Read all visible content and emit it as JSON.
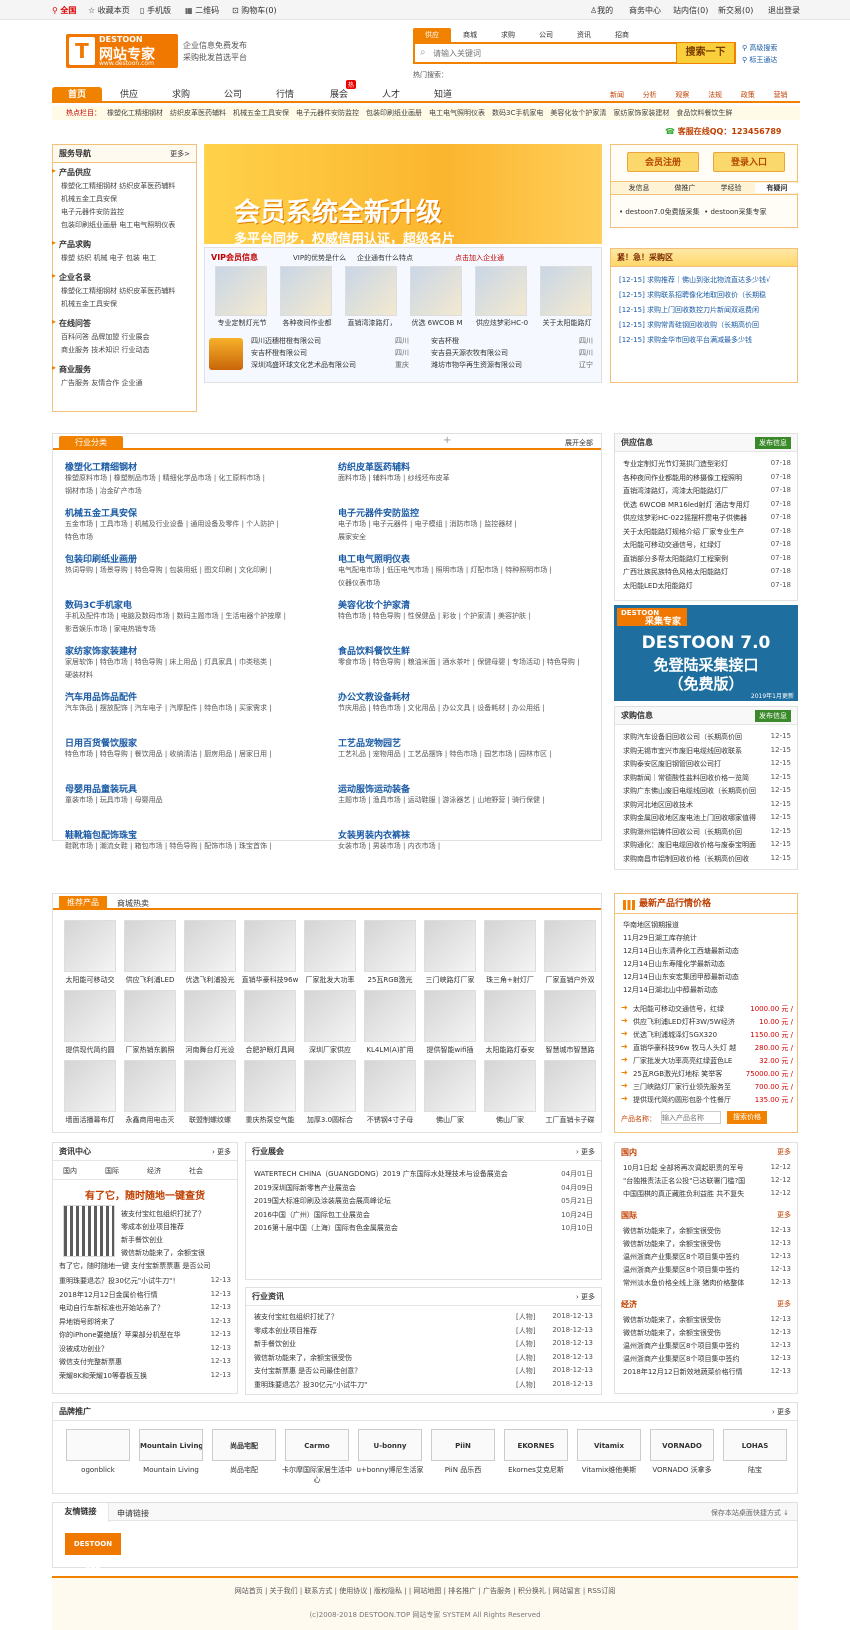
{
  "topbar": {
    "home": "全国",
    "fav": "收藏本页",
    "mobile": "手机版",
    "qr": "二维码",
    "cart": "购物车(0)",
    "me": "我的",
    "biz": "商务中心",
    "msg": "站内信(0)",
    "trade": "新交易(0)",
    "logout": "退出登录"
  },
  "logo": {
    "brand": "DESTOON",
    "name": "网站专家",
    "url": "www.destoon.com",
    "slogan1": "企业信息免费发布",
    "slogan2": "采购批发首选平台"
  },
  "search": {
    "tabs": [
      "供应",
      "商城",
      "求购",
      "公司",
      "资讯",
      "招商"
    ],
    "placeholder": "请输入关键词",
    "button": "搜索一下",
    "adv": "高级搜索",
    "label": "标王通达",
    "hot_label": "热门搜索："
  },
  "nav": {
    "items": [
      "首页",
      "供应",
      "求购",
      "公司",
      "行情",
      "展会",
      "人才",
      "知道"
    ],
    "hot_badge": "热",
    "sub": [
      "新闻",
      "分析",
      "观察",
      "法规",
      "政策",
      "营销"
    ]
  },
  "hotbar": {
    "label": "热点栏目：",
    "items": [
      "橡塑化工精细钢材",
      "纺织皮革医药辅料",
      "机械五金工具安保",
      "电子元器件安防监控",
      "包装印刷纸业画册",
      "电工电气照明仪表",
      "数码3C手机家电",
      "美容化妆个护家清",
      "家纺家饰家装建材",
      "食品饮料餐饮生鲜"
    ]
  },
  "qq": "客服在线QQ：123456789",
  "service_nav": {
    "title": "服务导航",
    "more": "更多>",
    "sections": [
      {
        "title": "产品供应",
        "rows": [
          "橡塑化工精细钢材  纺织皮革医药辅料",
          "机械五金工具安保",
          "电子元器件安防监控",
          "包装印刷纸业画册  电工电气照明仪表"
        ]
      },
      {
        "title": "产品求购",
        "rows": [
          "橡塑  纺织  机械  电子  包装  电工"
        ]
      },
      {
        "title": "企业名录",
        "rows": [
          "橡塑化工精细钢材  纺织皮革医药辅料",
          "机械五金工具安保"
        ]
      },
      {
        "title": "在线问答",
        "rows": [
          "百科问答  品牌加盟  行业展会",
          "商业服务  技术知识  行业动态"
        ]
      },
      {
        "title": "商业服务",
        "rows": [
          "广告服务  友情合作  企业通"
        ]
      }
    ]
  },
  "banner": {
    "title": "会员系统全新升级",
    "sub": "多平台同步，权威信用认证，超级名片"
  },
  "vip": {
    "tabs": [
      "VIP会员信息",
      "VIP的优势是什么",
      "企业通有什么特点",
      "点击加入企业通"
    ],
    "items": [
      "专业定制灯光节",
      "各种夜间作业都",
      "直销湾漆路灯，",
      "优选 6WCOB M",
      "供应炫梦彩HC-0",
      "关于太阳能路灯"
    ],
    "companies": [
      [
        "四川迈穗柑橙有限公司",
        "四川",
        "安吉杯橙",
        "四川"
      ],
      [
        "安吉杯橙有限公司",
        "四川",
        "安吉县天源农牧有限公司",
        "四川"
      ],
      [
        "深圳鸿盛环球文化艺术品有限公司",
        "重庆",
        "潍坊市物华再生资源有限公司",
        "辽宁"
      ]
    ]
  },
  "member": {
    "register": "会员注册",
    "login": "登录入口",
    "tabs": [
      "发信息",
      "做推广",
      "学经验",
      "有疑问"
    ],
    "items": [
      "destoon7.0免费版采集",
      "destoon采集专家"
    ]
  },
  "urgent": {
    "title": "紧！急！采购区",
    "items": [
      "[12-15] 求购推荐｜佛山到张北物流直达多少钱√",
      "[12-15] 求购联系招聘像化地取回收价（长期稳",
      "[12-15] 求购上门回收数控刀片新闻双返费闲",
      "[12-15] 求购常青硅钢回收收购（长期高价回",
      "[12-15] 求购金华市回收平台满减最多少钱"
    ]
  },
  "industry": {
    "tab": "行业分类",
    "expand": "展开全部",
    "cats": [
      {
        "t": "橡塑化工精细钢材",
        "s": [
          "橡塑原料市场  |  橡塑制品市场  |  精细化学品市场  |  化工原料市场  |",
          "钢材市场  |  冶金矿产市场"
        ]
      },
      {
        "t": "纺织皮革医药辅料",
        "s": [
          "面料市场  |  辅料市场  |  纱线坯布皮革"
        ]
      },
      {
        "t": "机械五金工具安保",
        "s": [
          "五金市场  |  工具市场  |  机械及行业设备  |  通用设备及零件  |  个人防护  |",
          "特色市场"
        ]
      },
      {
        "t": "电子元器件安防监控",
        "s": [
          "电子市场  |  电子元器件  |  电子模组  |  消防市场  |  监控器材  |",
          "展家安全"
        ]
      },
      {
        "t": "包装印刷纸业画册",
        "s": [
          "热词导购  |  场景导购  |  特色导购  |  包装用纸  |  图文印刷  |  文化印刷  |"
        ]
      },
      {
        "t": "电工电气照明仪表",
        "s": [
          "电气配电市场  |  低压电气市场  |  照明市场  |  灯配市场  |  特种照明市场  |",
          "仪器仪表市场"
        ]
      },
      {
        "t": "数码3C手机家电",
        "s": [
          "手机及配件市场  |  电脑及数码市场  |  数码主题市场  |  生活电器个护按摩  |",
          "影音娱乐市场  |  家电热销专场"
        ]
      },
      {
        "t": "美容化妆个护家清",
        "s": [
          "特色市场  |  特色导购  |  性保健品  |  彩妆  |  个护家清  |  美容护肤  |"
        ]
      },
      {
        "t": "家纺家饰家装建材",
        "s": [
          "家居软饰  |  特色市场  |  特色导购  |  床上用品  |  灯具家具  |  巾类毯类  |",
          "硬装材料"
        ]
      },
      {
        "t": "食品饮料餐饮生鲜",
        "s": [
          "零食市场  |  特色导购  |  粮油米面  |  酒水茶叶  |  保健母婴  |  专场活动  |  特色导购  |"
        ]
      },
      {
        "t": "汽车用品饰品配件",
        "s": [
          "汽车饰品  |  摆放配饰  |  汽车电子  |  汽摩配件  |  特色市场  |  买家需求  |"
        ]
      },
      {
        "t": "办公文教设备耗材",
        "s": [
          "节庆用品  |  特色市场  |  文化用品  |  办公文具  |  设备耗材  |  办公用纸  |"
        ]
      },
      {
        "t": "日用百货餐饮服家",
        "s": [
          "特色市场  |  特色导购  |  餐饮用品  |  收纳清洁  |  厨房用品  |  居家日用  |"
        ]
      },
      {
        "t": "工艺品宠物园艺",
        "s": [
          "工艺礼品  |  宠物用品  |  工艺品摆饰  |  特色市场  |  园艺市场  |  园林市区  |"
        ]
      },
      {
        "t": "母婴用品童装玩具",
        "s": [
          "童装市场  |  玩具市场  |  母婴用品"
        ]
      },
      {
        "t": "运动服饰运动装备",
        "s": [
          "主题市场  |  渔具市场  |  运动鞋服  |  游泳器艺  |  山地野营  |  骑行保健  |"
        ]
      },
      {
        "t": "鞋靴箱包配饰珠宝",
        "s": [
          "鞋靴市场  |  潮流女鞋  |  箱包市场  |  特色导购  |  配饰市场  |  珠宝首饰  |"
        ]
      },
      {
        "t": "女装男装内衣裤袜",
        "s": [
          "女装市场  |  男装市场  |  内衣市场  |"
        ]
      }
    ]
  },
  "supply": {
    "title": "供应信息",
    "btn": "发布信息",
    "items": [
      [
        "专业定制灯光节灯笼拱门造型彩灯",
        "07-18"
      ],
      [
        "各种夜间作业都能用的移摄像工程照明",
        "07-18"
      ],
      [
        "直销湾漆路灯，湾漆太阳能路灯厂",
        "07-18"
      ],
      [
        "优选 6WCOB MR16led射灯 酒店专用灯",
        "07-18"
      ],
      [
        "供应炫梦彩HC-022摇摆杆攒电子供佛器",
        "07-18"
      ],
      [
        "关于太阳能路灯规格介绍 厂家专业生产",
        "07-18"
      ],
      [
        "太阳能可移动交通信号，红绿灯",
        "07-18"
      ],
      [
        "直销部分多帮太阳能路灯工程案例",
        "07-18"
      ],
      [
        "广西壮族民族特色风格太阳能路灯",
        "07-18"
      ],
      [
        "太阳能LED太阳能路灯",
        "07-18"
      ]
    ]
  },
  "collect_ad": {
    "brand": "DESTOON",
    "name": "采集专家",
    "line1": "DESTOON 7.0",
    "line2": "免登陆采集接口",
    "line3": "（免费版）",
    "date": "2019年1月更新"
  },
  "purchase": {
    "title": "求购信息",
    "btn": "发布信息",
    "items": [
      [
        "求购汽车设备旧回收公司（长期高价回",
        "12-15"
      ],
      [
        "求购无锡市宜兴市废旧电缆线回收联系",
        "12-15"
      ],
      [
        "求购泰安区废旧钢管回收公司打",
        "12-15"
      ],
      [
        "求购新闻｜常德酸性盐料回收价格一览简",
        "12-15"
      ],
      [
        "求购广东佛山废旧电缆线回收（长期高价回",
        "12-15"
      ],
      [
        "求购河北地区回收技术",
        "12-15"
      ],
      [
        "求购金属回收地区废电池上门回收哪家值得",
        "12-15"
      ],
      [
        "求购滁州铝铸件回收公司（长期高价回",
        "12-15"
      ],
      [
        "求购通化：废旧电缆回收价格与废泰宝明面",
        "12-15"
      ],
      [
        "求购南昌市铝制回收价格（长期高价回收",
        "12-15"
      ]
    ]
  },
  "products": {
    "tabs": [
      "推荐产品",
      "商城热卖"
    ],
    "items": [
      "太阳能可移动交",
      "供应飞利浦LED",
      "优选飞利浦投光",
      "直销华豪科技96w",
      "厂家批发大功率",
      "25瓦RGB激光",
      "三门峡路灯厂家",
      "珠三角+射灯厂",
      "厂家直销户外双",
      "提供现代简约圆",
      "厂家热销东鹏照",
      "河南舞台灯光设",
      "合肥护眼灯具网",
      "深圳厂家供应",
      "KL4LM(A)扩用",
      "提供智能wifi插",
      "太阳能路灯泰安",
      "智慧城市智慧路",
      "墙面活播幕布灯",
      "永鑫商用电击灭",
      "联盟制螺纹螺",
      "重庆热泵空气能",
      "加厚3.0圆标合",
      "不锈钢4寸子母",
      "佛山厂家",
      "佛山厂家",
      "工厂直销卡子碟"
    ]
  },
  "price": {
    "title": "最新产品行情价格",
    "news": [
      "华南地区钢期报道",
      "11月29日湖工库存统计",
      "12月14日山东清养化工西塘最新动态",
      "12月14日山东寿隆化学最新动态",
      "12月14日山东安宏集团甲醇最新动态",
      "12月14日湖北山中醇最新动态"
    ],
    "items": [
      [
        "太阳能可移动交通信号，红绿",
        "1000.00 元 /"
      ],
      [
        "供应飞利浦LED灯杆3W/5W经济",
        "10.00 元 /"
      ],
      [
        "优选飞利浦城泽灯SGX320",
        "1150.00 元 /"
      ],
      [
        "直销华豪科技96w 牧马人头灯 越",
        "280.00 元 /"
      ],
      [
        "厂家批发大功率高亮红绿蓝色LE",
        "32.00 元 /"
      ],
      [
        "25瓦RGB激光灯地标 笑举客",
        "75000.00 元 /"
      ],
      [
        "三门峡路灯厂家行业领先服务至",
        "700.00 元 /"
      ],
      [
        "提供现代简约圆形包卧个性餐厅",
        "135.00 元 /"
      ]
    ],
    "search_label": "产品名称：",
    "search_ph": "输入产品名称",
    "search_btn": "搜索价格"
  },
  "news_center": {
    "title": "资讯中心",
    "more": "更多",
    "tabs": [
      "国内",
      "国际",
      "经济",
      "社会"
    ],
    "headline": "有了它，随时随地一键查货",
    "lead": [
      "被支付宝红包组织打扰了？",
      "零成本创业项目推荐",
      "新手餐饮创业",
      "微信新功能来了，余额宝很",
      "有了它，随时随地一键   支付宝新票票惠 是否公司"
    ],
    "items": [
      [
        "重明珠要退芯？投30亿元\"小试牛刀\"！",
        "12-13"
      ],
      [
        "2018年12月12日金属价格行情",
        "12-13"
      ],
      [
        "电动自行车新标准也开始站亲了？",
        "12-13"
      ],
      [
        "异地销号即将来了",
        "12-13"
      ],
      [
        "你的iPhone要绝版？苹果部分机型在华",
        "12-13"
      ],
      [
        "没被成功创业？",
        "12-13"
      ],
      [
        "微信支付完整新票惠",
        "12-13"
      ],
      [
        "荣耀8K和荣耀10等春板互换",
        "12-13"
      ]
    ]
  },
  "expo": {
    "title": "行业展会",
    "more": "更多",
    "items": [
      [
        "WATERTECH CHINA（GUANGDONG）2019 广东国际水处理技术与设备展览会",
        "04月01日"
      ],
      [
        "2019深圳国际新零售产业展览会",
        "04月09日"
      ],
      [
        "2019国大标准印刷及涂装展览会展高峰论坛",
        "05月21日"
      ],
      [
        "2016中国（广州）国际包工业展览会",
        "10月24日"
      ],
      [
        "2016第十届中国（上海）国际有色金属展览会",
        "10月10日"
      ]
    ]
  },
  "ind_news": {
    "title": "行业资讯",
    "more": "更多",
    "items": [
      [
        "被支付宝红包组织打扰了？",
        "[人物]",
        "2018-12-13"
      ],
      [
        "零成本创业项目推荐",
        "[人物]",
        "2018-12-13"
      ],
      [
        "新手餐饮创业",
        "[人物]",
        "2018-12-13"
      ],
      [
        "微信新功能来了，余额宝很受伤",
        "[人物]",
        "2018-12-13"
      ],
      [
        "支付宝新票惠 是否公司最佳创意？",
        "[人物]",
        "2018-12-13"
      ],
      [
        "重明珠要退芯？投30亿元\"小试牛刀\"",
        "[人物]",
        "2018-12-13"
      ]
    ]
  },
  "side_news": {
    "sections": [
      {
        "title": "国内",
        "more": "更多",
        "items": [
          [
            "10月1日起 全部将再次调起职责的军号",
            "12-12"
          ],
          [
            "\"台独推责法正名公投\"已达联署门槛?国",
            "12-12"
          ],
          [
            "中国围棋的真正藏胜负利益胜 共不复失",
            "12-12"
          ]
        ]
      },
      {
        "title": "国际",
        "more": "更多",
        "items": [
          [
            "微信新功能来了，余额宝很受伤",
            "12-13"
          ],
          [
            "微信新功能来了，余额宝很受伤",
            "12-13"
          ],
          [
            "温州浙商产业集聚区8个项目集中签约",
            "12-13"
          ],
          [
            "温州浙商产业集聚区8个项目集中签约",
            "12-13"
          ],
          [
            "常州淡水鱼价格全线上涨 猪肉价格整体",
            "12-13"
          ]
        ]
      },
      {
        "title": "经济",
        "more": "更多",
        "items": [
          [
            "微信新功能来了，余额宝很受伤",
            "12-13"
          ],
          [
            "微信新功能来了，余额宝很受伤",
            "12-13"
          ],
          [
            "温州浙商产业集聚区8个项目集中签约",
            "12-13"
          ],
          [
            "温州浙商产业集聚区8个项目集中签约",
            "12-13"
          ],
          [
            "2018年12月12日新效地蔬菜价格行情",
            "12-13"
          ]
        ]
      }
    ]
  },
  "brands": {
    "title": "品牌推广",
    "more": "更多",
    "items": [
      [
        "",
        "ogonblick"
      ],
      [
        "Mountain Living",
        "Mountain Living"
      ],
      [
        "尚品宅配",
        "尚品宅配"
      ],
      [
        "Carmo",
        "卡尔摩国际家居生活中心"
      ],
      [
        "U-bonny",
        "u+bonny博尼生活家"
      ],
      [
        "PiiN",
        "PiiN 品乐西"
      ],
      [
        "EKORNES",
        "Ekornes艾克尼斯"
      ],
      [
        "Vitamix",
        "Vitamix维他美斯"
      ],
      [
        "VORNADO",
        "VORNADO 沃拿多"
      ],
      [
        "LOHAS",
        "陆宝"
      ]
    ]
  },
  "links": {
    "tabs": [
      "友情链接",
      "申请链接"
    ],
    "right": "保存本站桌面快捷方式",
    "logo": "DESTOON B2B"
  },
  "footer": {
    "links": "网站首页 | 关于我们 | 联系方式 | 使用协议 | 版权隐私 | | 网站地图 | 排名推广 | 广告服务 | 积分换礼 | 网站留言 | RSS订阅",
    "copy": "(c)2008-2018 DESTOON.TOP 网站专家 SYSTEM All Rights Reserved"
  },
  "colors": {
    "accent": "#f08200",
    "link": "#1a5ba5",
    "price": "#d00000"
  }
}
